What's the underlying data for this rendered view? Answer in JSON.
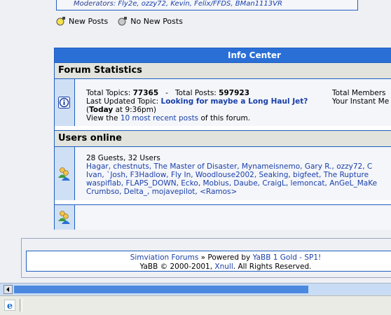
{
  "moderators": {
    "label": "Moderators:",
    "names": "Fly2e, ozzy72, Kevin, Felix/FFDS, BMan1113VR"
  },
  "legend": {
    "new_posts": "New Posts",
    "no_new_posts": "No New Posts"
  },
  "info_center": {
    "title": "Info Center",
    "forum_stats": {
      "heading": "Forum Statistics",
      "total_topics_label": "Total Topics:",
      "total_topics": "77365",
      "dash": "-",
      "total_posts_label": "Total Posts:",
      "total_posts": "597923",
      "total_members_label": "Total Members",
      "last_updated_label": "Last Updated Topic:",
      "last_updated_topic": "Looking for maybe a Long Haul Jet?",
      "instant_label": "Your Instant Me",
      "when_open": "(",
      "when_day": "Today",
      "when_time": "at 9:36pm)",
      "view_prefix": "View the",
      "recent_link": "10 most recent posts",
      "view_suffix": "of this forum."
    },
    "users_online": {
      "heading": "Users online",
      "summary": "28 Guests, 32 Users",
      "line1": "Hagar, chestnuts, The Master of Disaster, Mynameisnemo, Gary R., ozzy72, C",
      "line2": "Ivan, `Josh, F3Hadlow, Fly In, Woodlouse2002, Seaking, bigfeet, The Rupture",
      "line3": "waspiflab, FLAPS_DOWN, Ecko, Mobius, Daube, CraigL, lemoncat, AnGeL_MaKe",
      "line4": "Crumbso, Delta_, mojavepilot, <Ramos>"
    }
  },
  "footer": {
    "forum_link": "Simviation Forums",
    "powered": "» Powered by",
    "yabb_link": "YaBB 1 Gold - SP1!",
    "copyright": "YaBB © 2000-2001,",
    "xnull": "Xnull",
    "rights": ". All Rights Reserved."
  },
  "colors": {
    "header_blue": "#2a6fd6",
    "link": "#1a3fa8",
    "category_bg": "#e1e3dc"
  }
}
